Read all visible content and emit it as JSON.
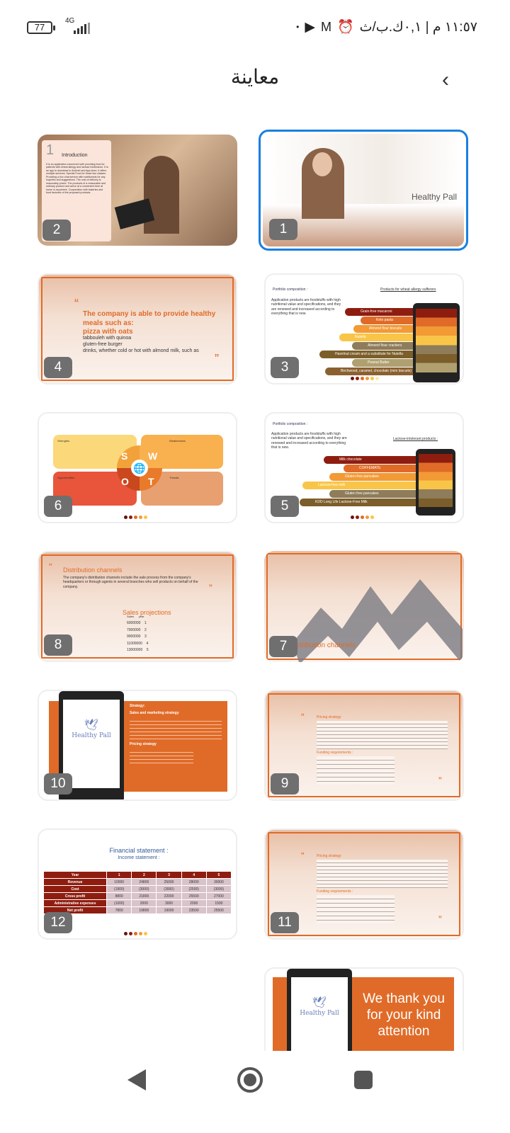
{
  "status": {
    "battery": "77",
    "network": "4G",
    "time": "١١:٥٧ م | ٠,١ك.ب/ث",
    "icons": [
      "alarm-icon",
      "gmail-icon",
      "play-icon",
      "dot-icon"
    ]
  },
  "header": {
    "title": "معاينة",
    "back_icon": "chevron-left-icon"
  },
  "slides": [
    {
      "num": "1",
      "title": "Healthy Pall",
      "selected": true
    },
    {
      "num": "2",
      "heading": "1",
      "title": "Introduction",
      "body": "It is an application concerned with providing food for patients with wheat allergy and lactose intolerance. It is an app to download in Android and App store, it offers multiple services. Special Food for those two classes. Providing a box chat service with nutritionists for any Inquiries and suggestions. The cost of delivery is reasonably priced. The products of a reasonable and ordinary product and arrive at a convenient time at home or anywhere. Cooperation with bakeries and food factories of the proposed products."
    },
    {
      "num": "3",
      "heading": "Portfolio composition :",
      "subtitle": "Products for wheat allergy sufferers",
      "body": "Application products are foodstuffs with high nutritional value and specifications, and they are renewed and increased according to everything that is new.",
      "items": [
        "Grain-free macaroni",
        "Keto pasta",
        "Almond flour biscuits",
        "Nutella",
        "Almond flour crackers",
        "Hazelnut cream and a substitute for Nutella",
        "Peanut Butter",
        "Birchwood, caramel, chocolate (mini biscuits)"
      ]
    },
    {
      "num": "4",
      "title": "The company is able to provide healthy meals such as:",
      "subtitle": "pizza with oats",
      "items": [
        "tabbouleh with quinoa",
        "gluten-free burger",
        "drinks, whether cold or hot with almond milk, such as"
      ]
    },
    {
      "num": "5",
      "heading": "Portfolio composition :",
      "subtitle": "Lactose-intolerant products :",
      "body": "Application products are foodstuffs with high nutritional value and specifications, and they are renewed and increased according to everything that is new.",
      "items": [
        "Milk chocolate",
        "COFFEMATE",
        "Gluten-free pancakes",
        "Lactose-free milk",
        "Gluten free pancakes",
        "KDD Long Life Lactose-Free Milk"
      ]
    },
    {
      "num": "6",
      "letters": [
        "S",
        "W",
        "O",
        "T"
      ],
      "labels": [
        "Strengths",
        "Weaknesses",
        "Opportunities",
        "Threats"
      ]
    },
    {
      "num": "7",
      "title": "Distribution channels"
    },
    {
      "num": "8",
      "title": "Distribution channels",
      "body": "The company's distribution channels include the sale process from the company's headquarters or through agents in several branches who sell products on behalf of the company.",
      "subtitle": "Sales projections",
      "cols": [
        "Sales",
        "year"
      ],
      "rows": [
        [
          "6000000",
          "1"
        ],
        [
          "7000000",
          "2"
        ],
        [
          "9000000",
          "3"
        ],
        [
          "11000000",
          "4"
        ],
        [
          "13000000",
          "5"
        ]
      ]
    },
    {
      "num": "9",
      "heading": "Pricing strategy",
      "sub": "Funding requirements :"
    },
    {
      "num": "10",
      "heading": "Strategy:",
      "subtitle": "Sales and marketing strategy",
      "sub": "Pricing strategy",
      "logo": "Healthy Pall"
    },
    {
      "num": "11",
      "heading": "Pricing strategy",
      "sub": "Funding requirements :"
    },
    {
      "num": "12",
      "title": "Financial statement :",
      "subtitle": "Income statement :",
      "table": {
        "header": [
          "Year",
          "1",
          "2",
          "3",
          "4",
          "5"
        ],
        "rows": [
          [
            "Revenue",
            "10000",
            "24800",
            "25000",
            "28000",
            "30000"
          ],
          [
            "Cost",
            "(1900)",
            "(3000)",
            "(3000)",
            "(2500)",
            "(3000)"
          ],
          [
            "Cross profit",
            "8800",
            "21800",
            "22000",
            "25500",
            "27000"
          ],
          [
            "Administrative expenses",
            "(1000)",
            "2000",
            "3000",
            "2000",
            "1500"
          ],
          [
            "Net profit",
            "7800",
            "19800",
            "19000",
            "23500",
            "25500"
          ]
        ]
      }
    },
    {
      "num": "13",
      "title": "We thank you for your kind attention",
      "logo": "Healthy Pall"
    }
  ],
  "nav": [
    "back-icon",
    "home-icon",
    "recents-icon"
  ],
  "colors": {
    "accent": "#e06b28",
    "selection": "#1a7fe0",
    "dark_red": "#8e1d10"
  }
}
